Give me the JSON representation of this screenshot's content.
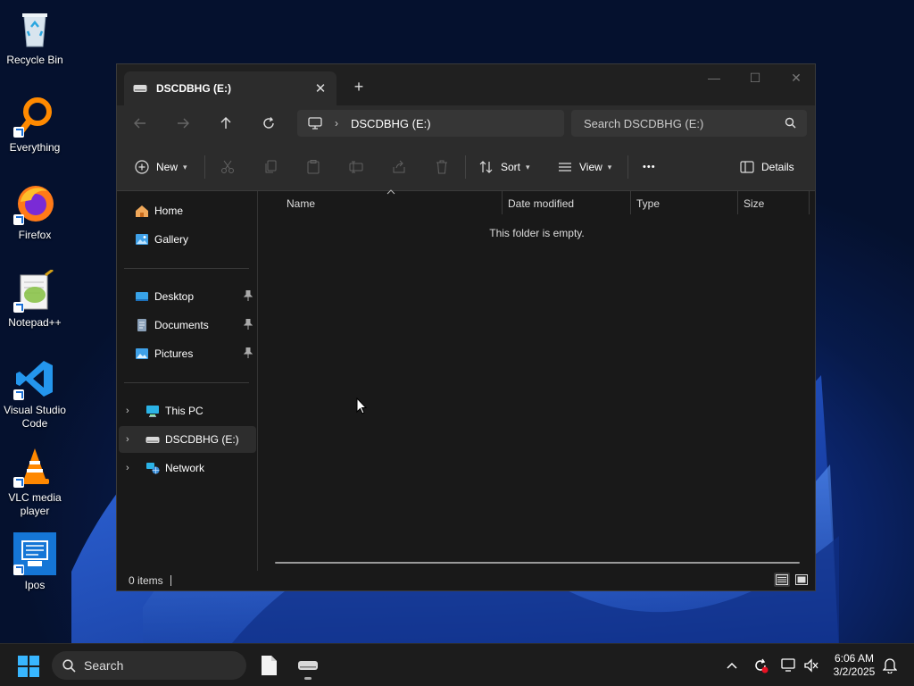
{
  "desktop": {
    "icons": [
      {
        "label": "Recycle Bin",
        "icon": "recycle-bin-icon"
      },
      {
        "label": "Everything",
        "icon": "everything-search-icon"
      },
      {
        "label": "Firefox",
        "icon": "firefox-icon"
      },
      {
        "label": "Notepad++",
        "icon": "notepad-plus-plus-icon"
      },
      {
        "label": "Visual Studio Code",
        "icon": "vscode-icon"
      },
      {
        "label": "VLC media player",
        "icon": "vlc-icon"
      },
      {
        "label": "Ipos",
        "icon": "ipos-icon"
      }
    ]
  },
  "explorer": {
    "tab": {
      "title": "DSCDBHG (E:)",
      "close": "✕",
      "new_tab": "+"
    },
    "window_controls": {
      "minimize": "—",
      "maximize": "☐",
      "close": "✕"
    },
    "address": {
      "crumb": "DSCDBHG (E:)",
      "separator": "›"
    },
    "search": {
      "placeholder": "Search DSCDBHG (E:)"
    },
    "toolbar": {
      "new_label": "New",
      "sort_label": "Sort",
      "view_label": "View",
      "more_label": "•••",
      "details_label": "Details"
    },
    "nav": {
      "home": "Home",
      "gallery": "Gallery",
      "desktop": "Desktop",
      "documents": "Documents",
      "pictures": "Pictures",
      "this_pc": "This PC",
      "drive": "DSCDBHG (E:)",
      "network": "Network"
    },
    "columns": {
      "name": "Name",
      "date_modified": "Date modified",
      "type": "Type",
      "size": "Size"
    },
    "empty_message": "This folder is empty.",
    "status": {
      "items": "0 items"
    }
  },
  "taskbar": {
    "search_label": "Search",
    "clock_time": "6:06 AM",
    "clock_date": "3/2/2025"
  },
  "colors": {
    "window_bg": "#191919",
    "chrome_bg": "#2c2c2c",
    "accent": "#60cdff",
    "taskbar_bg": "#1c1c1c"
  }
}
